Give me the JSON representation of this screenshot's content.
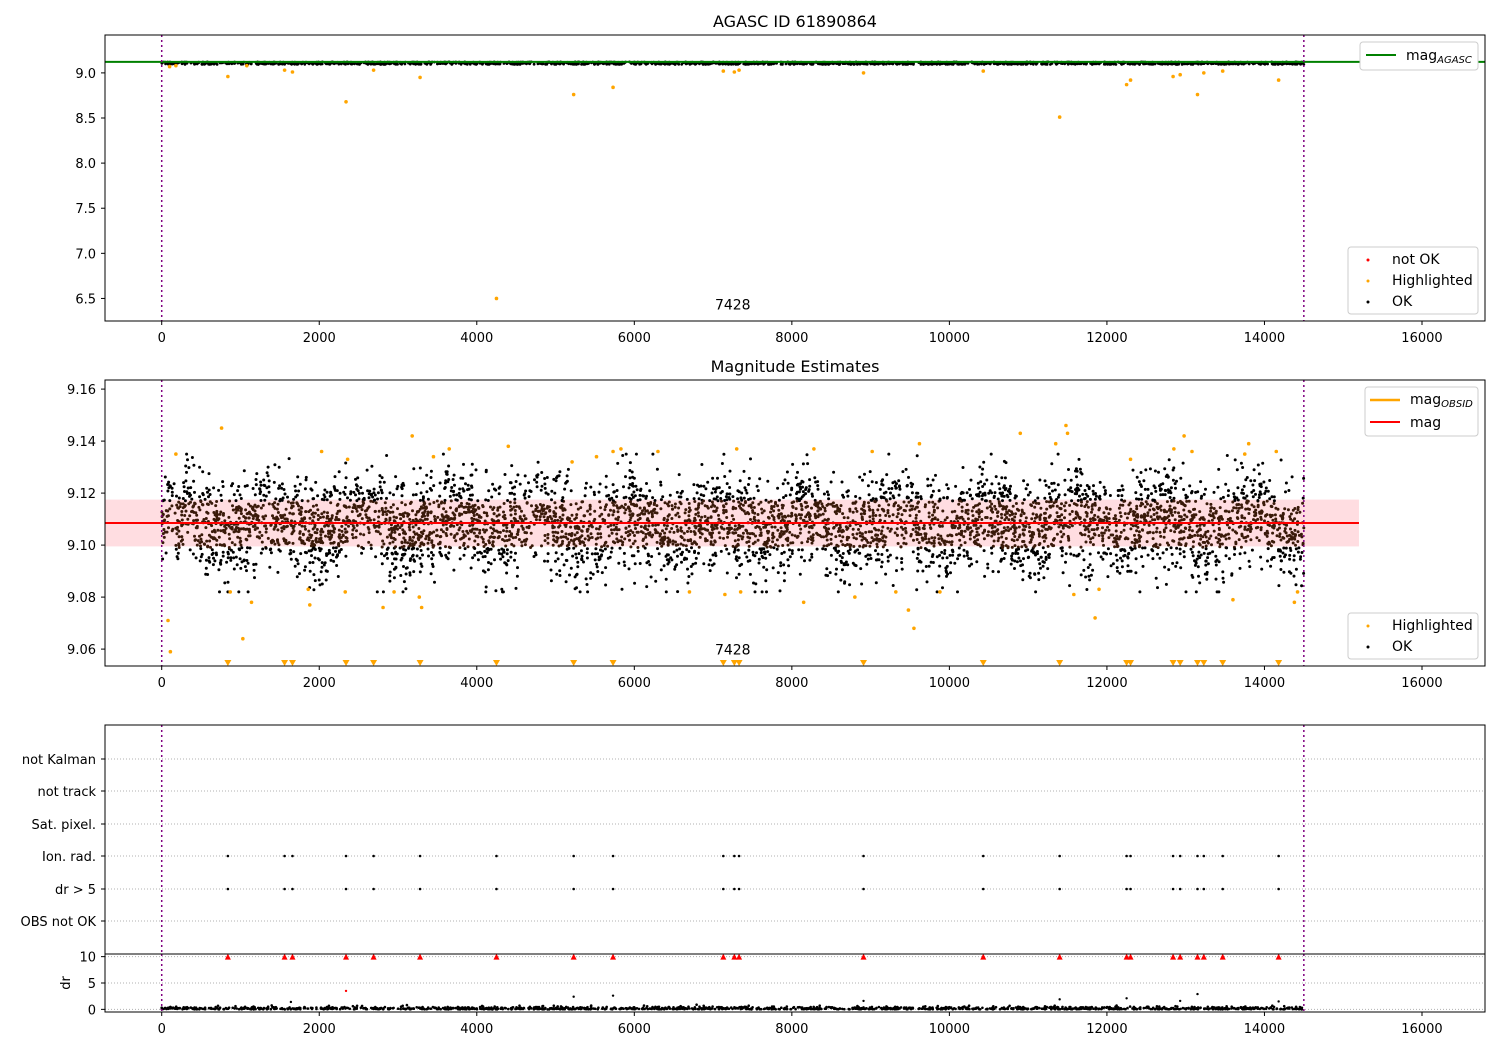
{
  "window_title": "AGASC ID 61890864",
  "annotation_text": "7428",
  "colors": {
    "ok": "#000000",
    "highlighted": "#ffa500",
    "not_ok": "#ff0000",
    "agasc_line": "#008000",
    "mag_line": "#ff0000",
    "mag_obsid_line": "#ffa500",
    "mag_band": "#ffdde1",
    "vline": "#800080",
    "guide": "#b0b0b0"
  },
  "chart_data": [
    {
      "type": "scatter",
      "title": "AGASC ID 61890864",
      "xlim": [
        -720,
        16800
      ],
      "ylim": [
        6.25,
        9.42
      ],
      "x_ticks": [
        0,
        2000,
        4000,
        6000,
        8000,
        10000,
        12000,
        14000,
        16000
      ],
      "y_ticks": [
        6.5,
        7.0,
        7.5,
        8.0,
        8.5,
        9.0
      ],
      "y_tick_labels": [
        "6.5",
        "7.0",
        "7.5",
        "8.0",
        "8.5",
        "9.0"
      ],
      "vlines_x": [
        0,
        14500
      ],
      "hline": {
        "y": 9.122,
        "name": "mag",
        "subscript": "AGASC"
      },
      "annotation": {
        "text": "7428",
        "x": 7250,
        "y": 6.38
      },
      "legend_markers": [
        "not OK",
        "Highlighted",
        "OK"
      ],
      "ok_band": {
        "x_range": [
          0,
          14500
        ],
        "center": 9.108,
        "half_width": 0.014
      },
      "highlighted_points": [
        [
          100,
          9.07
        ],
        [
          180,
          9.08
        ],
        [
          840,
          8.96
        ],
        [
          1080,
          9.08
        ],
        [
          1560,
          9.03
        ],
        [
          1660,
          9.01
        ],
        [
          2340,
          8.68
        ],
        [
          2690,
          9.03
        ],
        [
          3280,
          8.95
        ],
        [
          4250,
          6.5
        ],
        [
          5230,
          8.76
        ],
        [
          5730,
          8.84
        ],
        [
          7130,
          9.02
        ],
        [
          7270,
          9.01
        ],
        [
          7330,
          9.03
        ],
        [
          8910,
          9.0
        ],
        [
          10430,
          9.02
        ],
        [
          11400,
          8.51
        ],
        [
          12250,
          8.87
        ],
        [
          12300,
          8.92
        ],
        [
          12840,
          8.96
        ],
        [
          12930,
          8.98
        ],
        [
          13150,
          8.76
        ],
        [
          13230,
          9.0
        ],
        [
          13470,
          9.02
        ],
        [
          14180,
          8.92
        ]
      ]
    },
    {
      "type": "scatter",
      "title": "Magnitude Estimates",
      "xlim": [
        -720,
        16800
      ],
      "ylim": [
        9.0535,
        9.1635
      ],
      "x_ticks": [
        0,
        2000,
        4000,
        6000,
        8000,
        10000,
        12000,
        14000,
        16000
      ],
      "y_ticks": [
        9.06,
        9.08,
        9.1,
        9.12,
        9.14,
        9.16
      ],
      "y_tick_labels": [
        "9.06",
        "9.08",
        "9.10",
        "9.12",
        "9.14",
        "9.16"
      ],
      "vlines_x": [
        0,
        14500
      ],
      "mag": {
        "name": "mag",
        "y": 9.1085,
        "band": [
          9.0995,
          9.1175
        ]
      },
      "mag_obsid_legend": {
        "name": "mag",
        "subscript": "OBSID"
      },
      "annotation": {
        "text": "7428",
        "x": 7250,
        "y": 9.058
      },
      "legend_markers": [
        "Highlighted",
        "OK"
      ],
      "ok_cloud": {
        "x_range": [
          0,
          14500
        ],
        "center": 9.108,
        "spread": 0.009,
        "count": 5200
      },
      "highlighted_points": [
        [
          80,
          9.071
        ],
        [
          110,
          9.059
        ],
        [
          180,
          9.135
        ],
        [
          760,
          9.145
        ],
        [
          870,
          9.082
        ],
        [
          1030,
          9.064
        ],
        [
          1140,
          9.078
        ],
        [
          1860,
          9.083
        ],
        [
          1880,
          9.077
        ],
        [
          2030,
          9.136
        ],
        [
          2330,
          9.082
        ],
        [
          2360,
          9.133
        ],
        [
          2810,
          9.076
        ],
        [
          2950,
          9.082
        ],
        [
          3180,
          9.142
        ],
        [
          3270,
          9.08
        ],
        [
          3300,
          9.076
        ],
        [
          3450,
          9.134
        ],
        [
          3650,
          9.137
        ],
        [
          4400,
          9.138
        ],
        [
          5210,
          9.132
        ],
        [
          5520,
          9.134
        ],
        [
          5730,
          9.136
        ],
        [
          5830,
          9.137
        ],
        [
          6300,
          9.136
        ],
        [
          6700,
          9.082
        ],
        [
          7150,
          9.081
        ],
        [
          7300,
          9.137
        ],
        [
          7350,
          9.082
        ],
        [
          8150,
          9.078
        ],
        [
          8280,
          9.137
        ],
        [
          8800,
          9.08
        ],
        [
          9020,
          9.136
        ],
        [
          9320,
          9.082
        ],
        [
          9480,
          9.075
        ],
        [
          9550,
          9.068
        ],
        [
          9620,
          9.139
        ],
        [
          9880,
          9.082
        ],
        [
          10900,
          9.143
        ],
        [
          11350,
          9.139
        ],
        [
          11480,
          9.146
        ],
        [
          11500,
          9.143
        ],
        [
          11580,
          9.081
        ],
        [
          11850,
          9.072
        ],
        [
          11900,
          9.083
        ],
        [
          12300,
          9.133
        ],
        [
          12850,
          9.137
        ],
        [
          12980,
          9.142
        ],
        [
          13080,
          9.136
        ],
        [
          13600,
          9.079
        ],
        [
          13750,
          9.135
        ],
        [
          13800,
          9.139
        ],
        [
          14150,
          9.136
        ],
        [
          14380,
          9.078
        ],
        [
          14420,
          9.082
        ]
      ],
      "below_range_markers_x": [
        840,
        1560,
        1660,
        2340,
        2690,
        3280,
        4250,
        5230,
        5730,
        7130,
        7270,
        7330,
        8910,
        10430,
        11400,
        12250,
        12300,
        12840,
        12930,
        13150,
        13230,
        13470,
        14180
      ]
    },
    {
      "type": "scatter",
      "title": "",
      "xlim": [
        -720,
        16800
      ],
      "x_ticks": [
        0,
        2000,
        4000,
        6000,
        8000,
        10000,
        12000,
        14000,
        16000
      ],
      "vlines_x": [
        0,
        14500
      ],
      "flag_rows": [
        "not Kalman",
        "not track",
        "Sat. pixel.",
        "Ion. rad.",
        "dr > 5",
        "OBS not OK"
      ],
      "flagged_x": [
        840,
        1560,
        1660,
        2340,
        2690,
        3280,
        4250,
        5230,
        5730,
        7130,
        7270,
        7330,
        8910,
        10430,
        11400,
        12250,
        12300,
        12840,
        12930,
        13150,
        13230,
        13470,
        14180
      ],
      "flagged_rows": [
        "Ion. rad.",
        "dr > 5"
      ],
      "dr": {
        "ylabel": "dr",
        "ylim": [
          -0.5,
          10.5
        ],
        "y_ticks": [
          0,
          5,
          10
        ],
        "y_tick_labels": [
          "0",
          "5",
          "10"
        ],
        "clipped_at": 10,
        "outliers": [
          [
            1640,
            1.4
          ],
          [
            2340,
            3.5
          ],
          [
            5230,
            2.4
          ],
          [
            5730,
            2.6
          ],
          [
            8910,
            1.6
          ],
          [
            11400,
            1.9
          ],
          [
            12250,
            2.1
          ],
          [
            12930,
            1.6
          ],
          [
            13150,
            2.9
          ],
          [
            14180,
            1.5
          ]
        ]
      }
    }
  ]
}
